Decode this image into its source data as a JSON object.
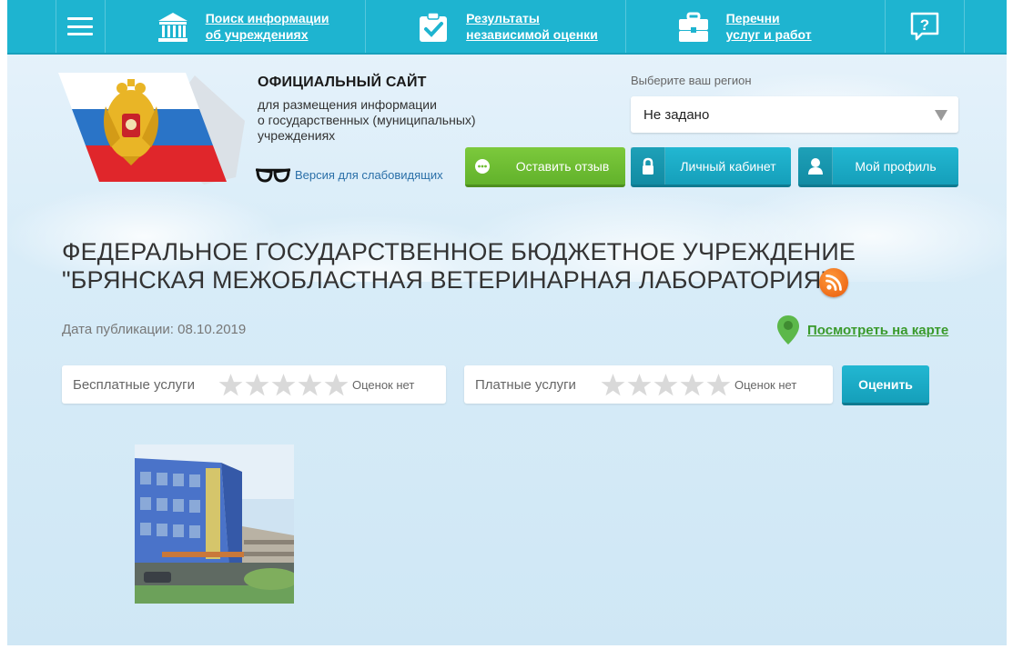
{
  "nav": {
    "items": [
      {
        "line1": "Поиск информации",
        "line2": "об учреждениях"
      },
      {
        "line1": "Результаты",
        "line2": "независимой оценки"
      },
      {
        "line1": "Перечни",
        "line2": "услуг и работ"
      }
    ]
  },
  "header": {
    "title": "ОФИЦИАЛЬНЫЙ САЙТ",
    "subtitle": [
      "для размещения информации",
      "о государственных (муниципальных)",
      "учреждениях"
    ],
    "low_vision": "Версия для слабовидящих",
    "region_label": "Выберите ваш регион",
    "region_value": "Не задано"
  },
  "buttons": {
    "feedback": "Оставить отзыв",
    "cabinet": "Личный кабинет",
    "profile": "Мой профиль",
    "rate": "Оценить"
  },
  "institution": {
    "title_line1": "ФЕДЕРАЛЬНОЕ ГОСУДАРСТВЕННОЕ БЮДЖЕТНОЕ УЧРЕЖДЕНИЕ",
    "title_line2": "\"БРЯНСКАЯ МЕЖОБЛАСТНАЯ ВЕТЕРИНАРНАЯ ЛАБОРАТОРИЯ\"",
    "pub_date": "Дата публикации: 08.10.2019",
    "map_link": "Посмотреть на карте"
  },
  "ratings": {
    "free": {
      "label": "Бесплатные услуги",
      "stars": 0,
      "max": 5,
      "status": "Оценок нет"
    },
    "paid": {
      "label": "Платные услуги",
      "stars": 0,
      "max": 5,
      "status": "Оценок нет"
    }
  },
  "colors": {
    "nav": "#1eb4d0",
    "green_button": "#6fbe33",
    "blue_button": "#1cabc7",
    "map_link": "#3a9a2c",
    "rss": "#f07a1c"
  },
  "icons": {
    "nav": [
      "menu-icon",
      "building-icon",
      "clipboard-check-icon",
      "briefcase-icon",
      "help-icon"
    ],
    "feedback": "speech-bubble-icon",
    "cabinet": "lock-icon",
    "profile": "user-icon",
    "rss": "rss-icon",
    "map": "map-pin-icon",
    "low_vision": "glasses-icon"
  }
}
